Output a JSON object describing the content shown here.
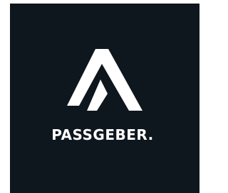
{
  "brand": {
    "name": "PASSGEBER.",
    "logo_icon": "passgeber-a-mark-icon",
    "colors": {
      "background": "#0e161e",
      "mark": "#ffffff",
      "text": "#ffffff"
    }
  }
}
